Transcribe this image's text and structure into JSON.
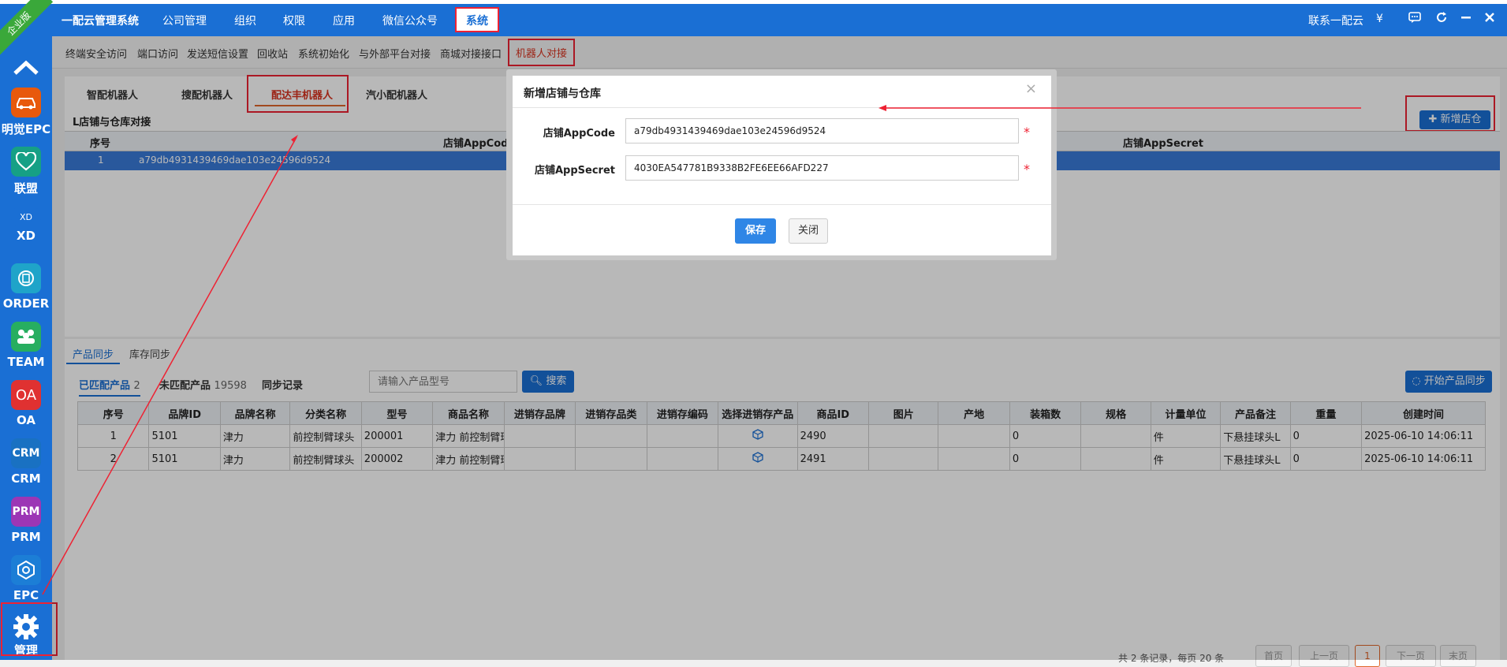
{
  "app": {
    "brand": "一配云管理系统",
    "edition_badge": "企业版"
  },
  "topbar": {
    "menus": [
      "公司管理",
      "组织",
      "权限",
      "应用",
      "微信公众号"
    ],
    "active_menu": "系统",
    "contact": "联系一配云",
    "currency_symbol": "¥",
    "icons": [
      "chat-icon",
      "refresh-icon",
      "minimize-icon",
      "close-icon"
    ]
  },
  "sidebar": {
    "items": [
      {
        "label": "明觉EPC",
        "icon": "car-icon",
        "color": "#e8590c"
      },
      {
        "label": "联盟",
        "icon": "heart-icon",
        "color": "#16a085"
      },
      {
        "label": "XD",
        "icon": "xd-icon",
        "icon_text": "XD",
        "color": "#1a6fd4"
      },
      {
        "label": "ORDER",
        "icon": "order-icon",
        "color": "#1fa4c9"
      },
      {
        "label": "TEAM",
        "icon": "team-icon",
        "color": "#27ae60"
      },
      {
        "label": "OA",
        "icon": "oa-icon",
        "icon_text": "OA",
        "color": "#e03131"
      },
      {
        "label": "CRM",
        "icon": "crm-icon",
        "icon_text": "CRM",
        "color": "#1971c2"
      },
      {
        "label": "PRM",
        "icon": "prm-icon",
        "icon_text": "PRM",
        "color": "#9c36b5"
      },
      {
        "label": "EPC",
        "icon": "epc-icon",
        "color": "#1c7ed6"
      },
      {
        "label": "管理",
        "icon": "gear-icon",
        "color": "#1a6fd4"
      }
    ]
  },
  "subnav": {
    "items": [
      "终端安全访问",
      "端口访问",
      "发送短信设置",
      "回收站",
      "系统初始化",
      "与外部平台对接",
      "商城对接接口"
    ],
    "active": "机器人对接"
  },
  "robot_tabs": {
    "items": [
      "智配机器人",
      "搜配机器人",
      "配达丰机器人",
      "汽小配机器人"
    ],
    "active_index": 2
  },
  "store_section": {
    "title": "L店铺与仓库对接",
    "add_button": "新增店仓",
    "columns": [
      "序号",
      "店铺AppCode",
      "店铺AppSecret"
    ],
    "rows": [
      {
        "index": "1",
        "app_code": "a79db4931439469dae103e24596d9524"
      }
    ]
  },
  "sync": {
    "tabs": [
      "产品同步",
      "库存同步"
    ],
    "filters": [
      {
        "label": "已匹配产品",
        "count": "2"
      },
      {
        "label": "未匹配产品",
        "count": "19598"
      },
      {
        "label": "同步记录",
        "count": ""
      }
    ],
    "search_placeholder": "请输入产品型号",
    "search_button": "搜索",
    "sync_button": "开始产品同步",
    "columns": [
      "序号",
      "品牌ID",
      "品牌名称",
      "分类名称",
      "型号",
      "商品名称",
      "进销存品牌",
      "进销存品类",
      "进销存编码",
      "选择进销存产品",
      "商品ID",
      "图片",
      "产地",
      "装箱数",
      "规格",
      "计量单位",
      "产品备注",
      "重量",
      "创建时间"
    ],
    "rows": [
      [
        "1",
        "5101",
        "津力",
        "前控制臂球头",
        "200001",
        "津力 前控制臂球头",
        "",
        "",
        "",
        "",
        "2490",
        "",
        "",
        "0",
        "",
        "件",
        "下悬挂球头L",
        "0",
        "2025-06-10 14:06:11"
      ],
      [
        "2",
        "5101",
        "津力",
        "前控制臂球头",
        "200002",
        "津力 前控制臂球头",
        "",
        "",
        "",
        "",
        "2491",
        "",
        "",
        "0",
        "",
        "件",
        "下悬挂球头L",
        "0",
        "2025-06-10 14:06:11"
      ]
    ],
    "pager": {
      "summary": "共 2 条记录，每页 20 条",
      "buttons": [
        "首页",
        "上一页",
        "1",
        "下一页",
        "末页"
      ]
    }
  },
  "modal": {
    "title": "新增店铺与仓库",
    "fields": [
      {
        "label": "店铺AppCode",
        "value": "a79db4931439469dae103e24596d9524"
      },
      {
        "label": "店铺AppSecret",
        "value": "4030EA547781B9338B2FE6EE66AFD227"
      }
    ],
    "required_mark": "*",
    "save": "保存",
    "close": "关闭",
    "close_icon": "×"
  },
  "colors": {
    "primary": "#1a6fd4",
    "annotation": "#e23",
    "active_orange": "#e0662a"
  }
}
